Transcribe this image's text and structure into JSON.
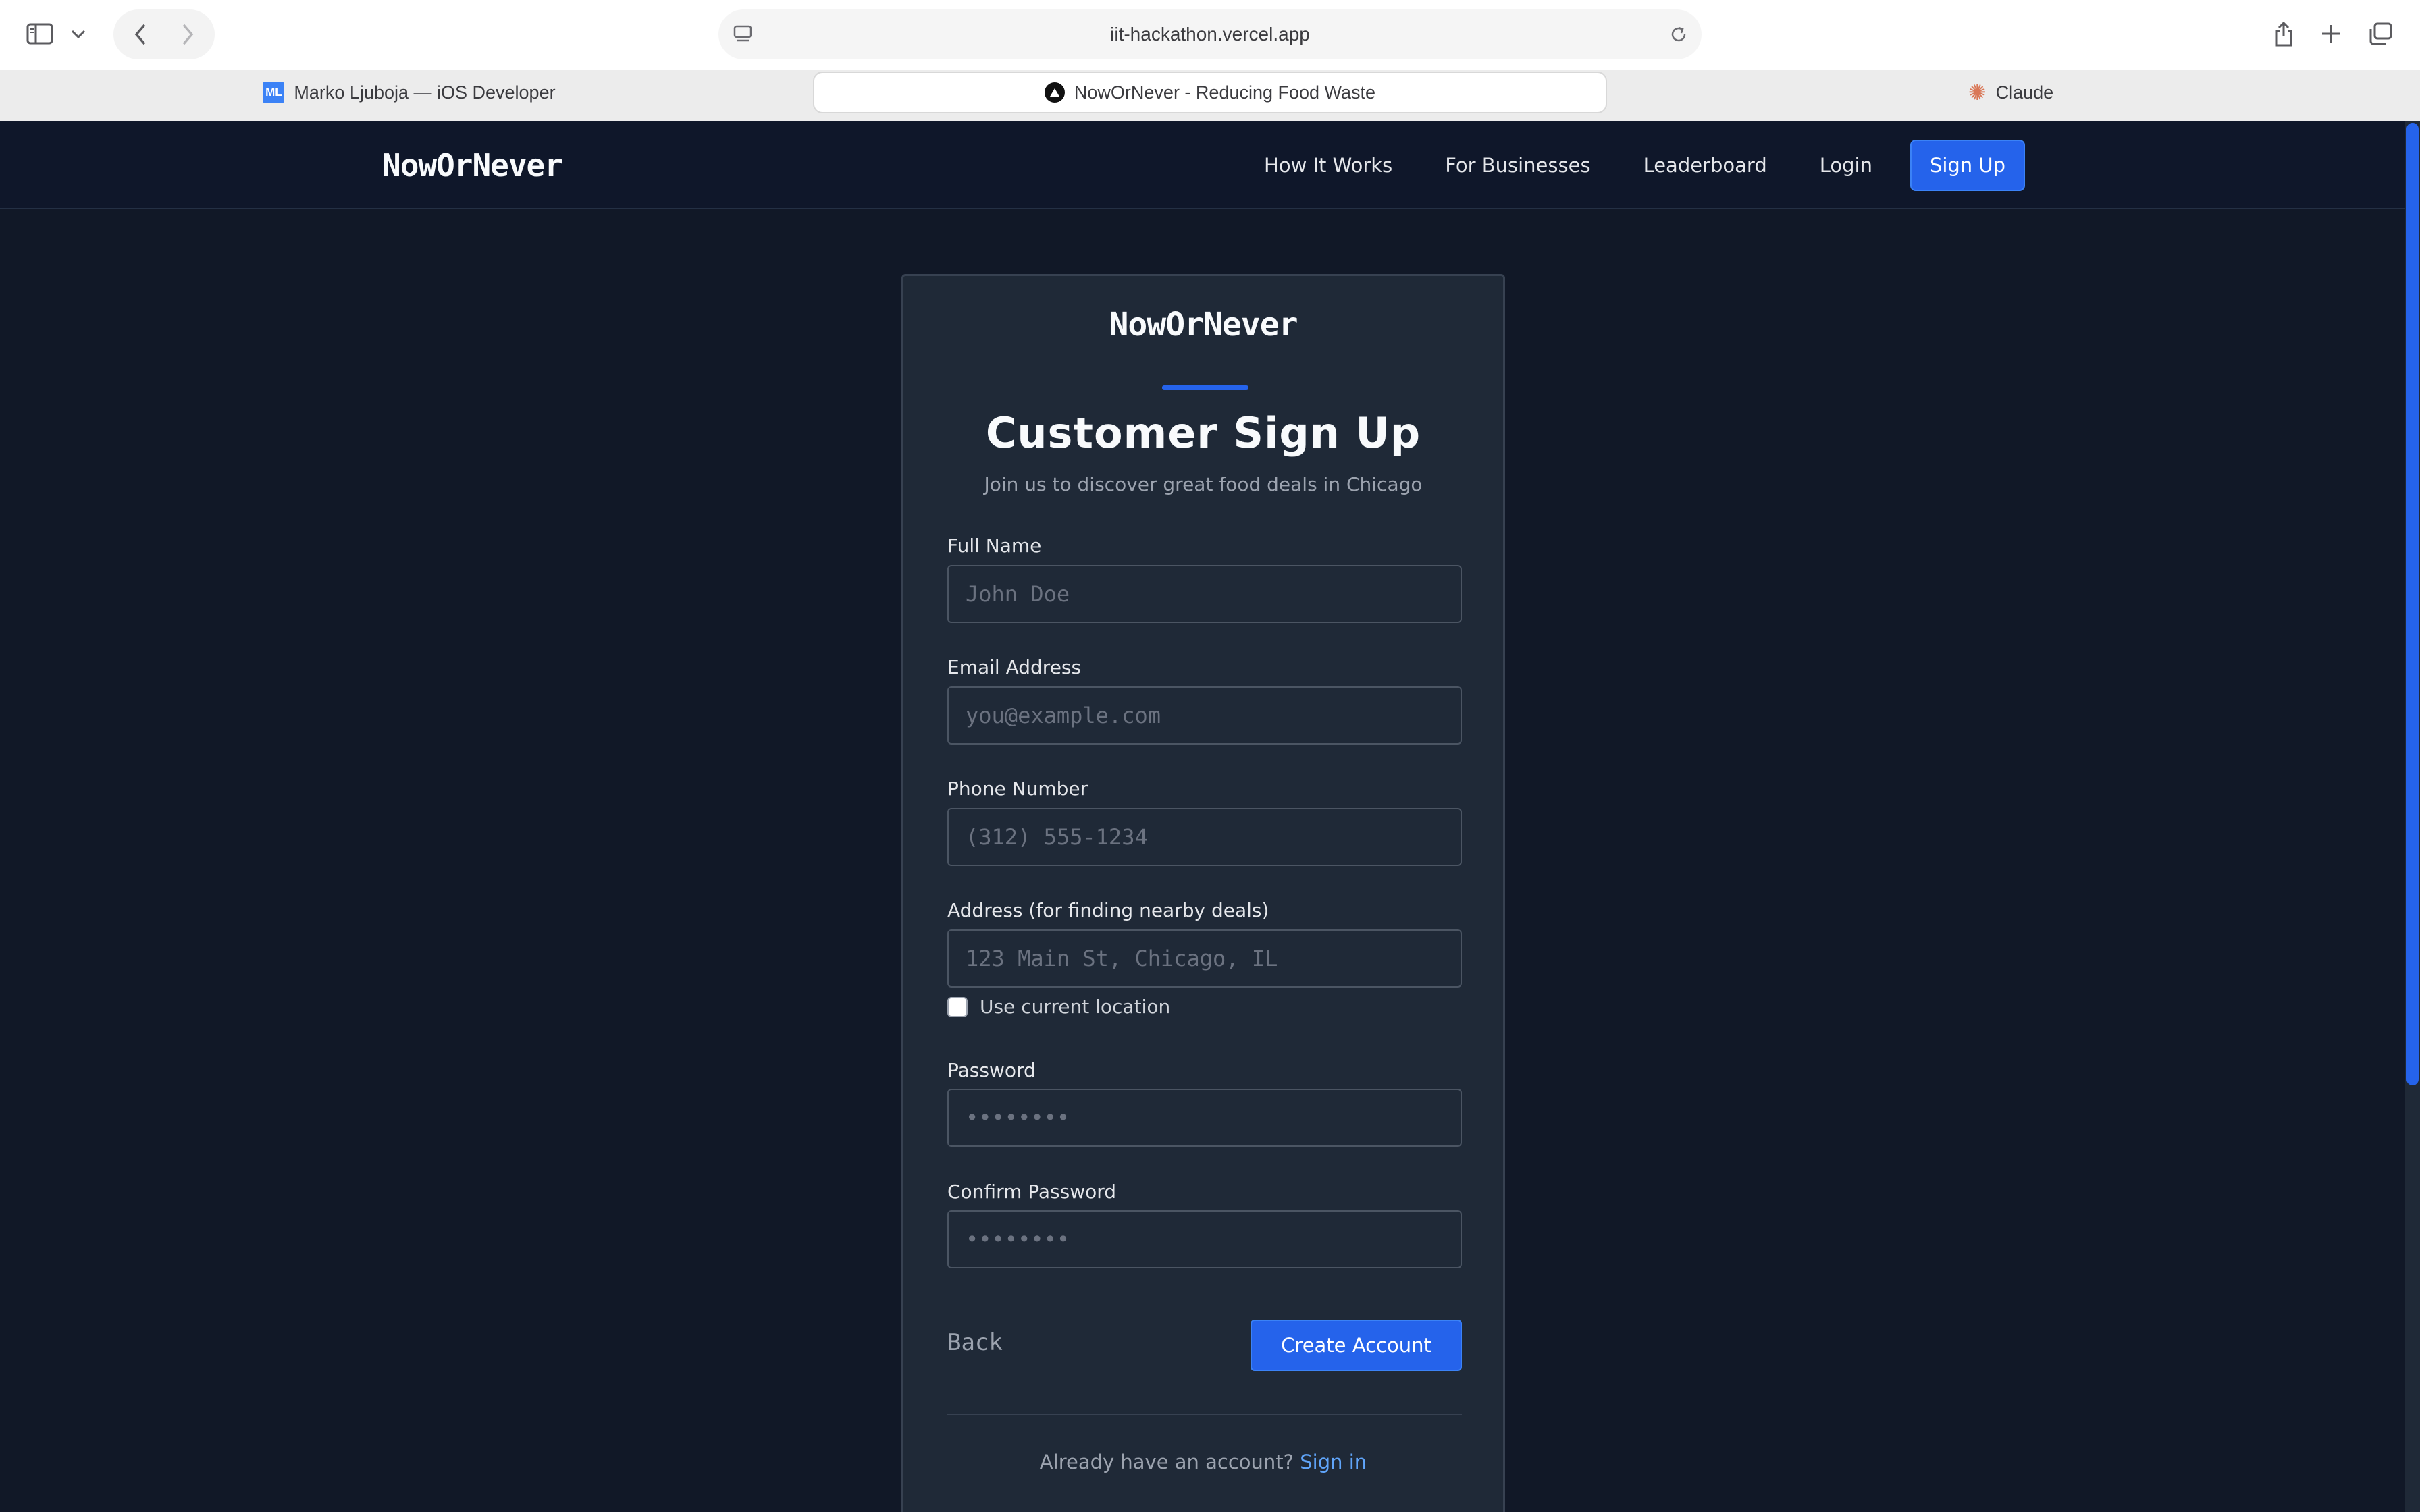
{
  "browser": {
    "url": "iit-hackathon.vercel.app",
    "tabs": [
      {
        "label": "Marko Ljuboja — iOS Developer",
        "favicon": "ML"
      },
      {
        "label": "NowOrNever - Reducing Food Waste",
        "favicon": "vercel-triangle-icon"
      },
      {
        "label": "Claude",
        "favicon": "claude-sparkle-icon"
      }
    ],
    "icons": [
      "sidebar-icon",
      "chevron-down-icon",
      "back-arrow-icon",
      "forward-arrow-icon",
      "reader-icon",
      "reload-icon",
      "share-icon",
      "new-tab-icon",
      "tab-overview-icon"
    ]
  },
  "nav": {
    "brand": "NowOrNever",
    "links": [
      "How It Works",
      "For Businesses",
      "Leaderboard",
      "Login"
    ],
    "signup": "Sign Up"
  },
  "card": {
    "brand": "NowOrNever",
    "title": "Customer Sign Up",
    "subtitle": "Join us to discover great food deals in Chicago",
    "fields": {
      "full_name": {
        "label": "Full Name",
        "placeholder": "John Doe"
      },
      "email": {
        "label": "Email Address",
        "placeholder": "you@example.com"
      },
      "phone": {
        "label": "Phone Number",
        "placeholder": "(312) 555-1234"
      },
      "address": {
        "label": "Address (for finding nearby deals)",
        "placeholder": "123 Main St, Chicago, IL"
      },
      "password": {
        "label": "Password",
        "placeholder": "••••••••"
      },
      "confirm_password": {
        "label": "Confirm Password",
        "placeholder": "••••••••"
      }
    },
    "use_location_label": "Use current location",
    "back": "Back",
    "create_account": "Create Account",
    "already_have": "Already have an account?",
    "sign_in": "Sign in"
  },
  "colors": {
    "accent": "#2563eb",
    "page_bg": "#111827",
    "card_bg": "#1f2937",
    "link": "#60a5fa"
  }
}
